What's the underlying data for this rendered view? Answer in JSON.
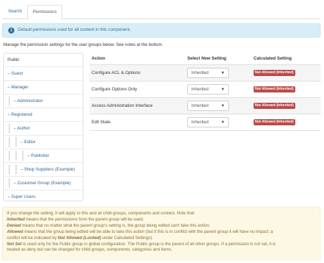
{
  "tabs": [
    {
      "label": "Search",
      "active": false
    },
    {
      "label": "Permissions",
      "active": true
    }
  ],
  "info": {
    "icon": "info-icon",
    "text": "Default permissions used for all content in this component."
  },
  "manage_text": "Manage the permission settings for the user groups below. See notes at the bottom.",
  "groups": [
    {
      "label": "Public",
      "depth": 0
    },
    {
      "label": "– Guest",
      "depth": 1
    },
    {
      "label": "– Manager",
      "depth": 1
    },
    {
      "label": "– Administrator",
      "depth": 2
    },
    {
      "label": "– Registered",
      "depth": 1
    },
    {
      "label": "– Author",
      "depth": 2
    },
    {
      "label": "– Editor",
      "depth": 3
    },
    {
      "label": "– Publisher",
      "depth": 4
    },
    {
      "label": "– Shop Suppliers (Example)",
      "depth": 3
    },
    {
      "label": "– Customer Group (Example)",
      "depth": 2
    },
    {
      "label": "– Super Users",
      "depth": 1
    }
  ],
  "table": {
    "headers": {
      "action": "Action",
      "setting": "Select New Setting",
      "calculated": "Calculated Setting"
    },
    "rows": [
      {
        "action": "Configure ACL & Options",
        "setting": "Inherited",
        "calculated": "Not Allowed (Inherited)"
      },
      {
        "action": "Configure Options Only",
        "setting": "Inherited",
        "calculated": "Not Allowed (Inherited)"
      },
      {
        "action": "Access Administration Interface",
        "setting": "Inherited",
        "calculated": "Not Allowed (Inherited)"
      },
      {
        "action": "Edit State",
        "setting": "Inherited",
        "calculated": "Not Allowed (Inherited)"
      }
    ],
    "select_icon": "chevron-down-icon"
  },
  "notes": {
    "line1": "If you change the setting, it will apply to this and all child groups, components and content. Note that:",
    "inherited_term": "Inherited",
    "inherited_text": " means that the permissions from the parent group will be used.",
    "denied_term": "Denied",
    "denied_text": " means that no matter what the parent group's setting is, the group being edited can't take this action.",
    "allowed_term": "Allowed",
    "allowed_text": " means that the group being edited will be able to take this action (but if this is in conflict with the parent group it will have no impact; a",
    "line5a": "conflict will be indicated by ",
    "locked_term": "Not Allowed (Locked)",
    "line5b": " under Calculated Settings).",
    "notset_term": "Not Set",
    "notset_text": " is used only for the Public group in global configuration. The Public group is the parent of all other groups. If a permission is not set, it is",
    "line7": "treated as deny but can be changed for child groups, components, categories and items."
  },
  "colors": {
    "link": "#2a6496",
    "info_bg": "#d9edf7",
    "info_text": "#31708f",
    "badge": "#b94a48",
    "warning_bg": "#fcf8e3",
    "warning_text": "#8a6d3b"
  }
}
